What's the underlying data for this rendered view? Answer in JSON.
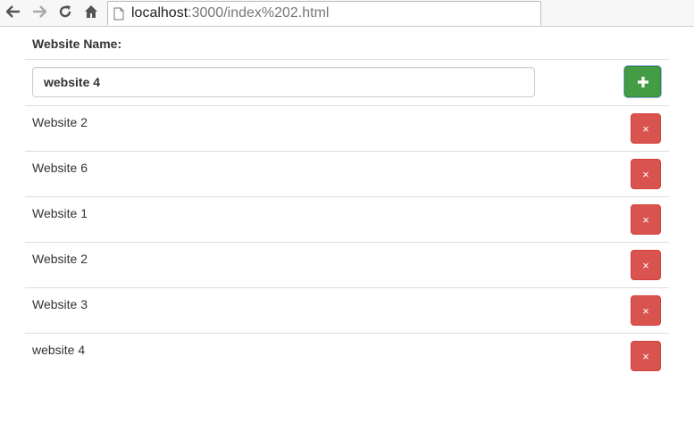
{
  "browser": {
    "url_host": "localhost",
    "url_path": ":3000/index%202.html"
  },
  "form": {
    "label": "Website Name:",
    "input_value": "website 4",
    "add_icon": "plus-icon",
    "add_color": "#449d44",
    "delete_color": "#d9534f"
  },
  "websites": [
    {
      "name": "Website 2",
      "delete_label": "×"
    },
    {
      "name": "Website 6",
      "delete_label": "×"
    },
    {
      "name": "Website 1",
      "delete_label": "×"
    },
    {
      "name": "Website 2",
      "delete_label": "×"
    },
    {
      "name": "Website 3",
      "delete_label": "×"
    },
    {
      "name": "website 4",
      "delete_label": "×"
    }
  ]
}
